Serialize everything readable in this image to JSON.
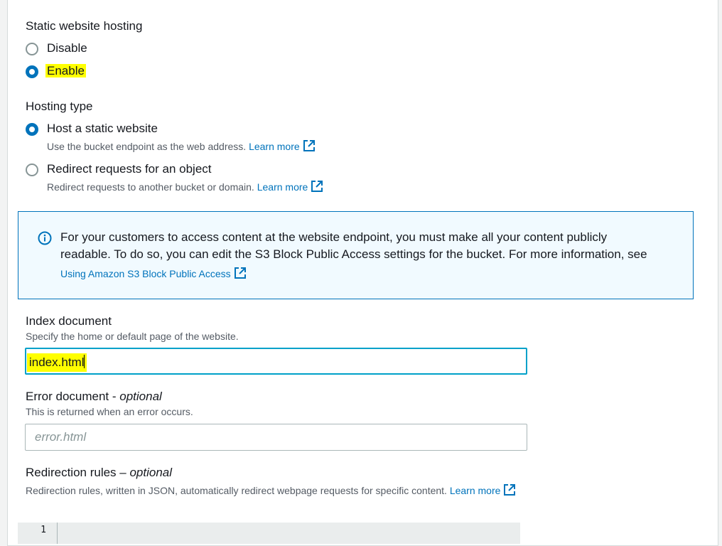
{
  "static_hosting": {
    "title": "Static website hosting",
    "options": [
      {
        "label": "Disable",
        "checked": false
      },
      {
        "label": "Enable",
        "checked": true
      }
    ]
  },
  "hosting_type": {
    "title": "Hosting type",
    "options": [
      {
        "label": "Host a static website",
        "desc": "Use the bucket endpoint as the web address.",
        "link": "Learn more",
        "checked": true
      },
      {
        "label": "Redirect requests for an object",
        "desc": "Redirect requests to another bucket or domain.",
        "link": "Learn more",
        "checked": false
      }
    ]
  },
  "info_alert": {
    "line1": "For your customers to access content at the website endpoint, you must make all your content publicly",
    "line2": "readable. To do so, you can edit the S3 Block Public Access settings for the bucket. For more information, see",
    "link": "Using Amazon S3 Block Public Access"
  },
  "index_document": {
    "label": "Index document",
    "desc": "Specify the home or default page of the website.",
    "value": "index.html"
  },
  "error_document": {
    "label": "Error document - ",
    "optional": "optional",
    "desc": "This is returned when an error occurs.",
    "placeholder": "error.html"
  },
  "redirection_rules": {
    "label": "Redirection rules – ",
    "optional": "optional",
    "desc": "Redirection rules, written in JSON, automatically redirect webpage requests for specific content.",
    "link": "Learn more",
    "line_number": "1"
  },
  "colors": {
    "accent": "#0073bb",
    "highlight": "#ffff00",
    "info_bg": "#f1faff",
    "focus_border": "#00a1c9"
  }
}
